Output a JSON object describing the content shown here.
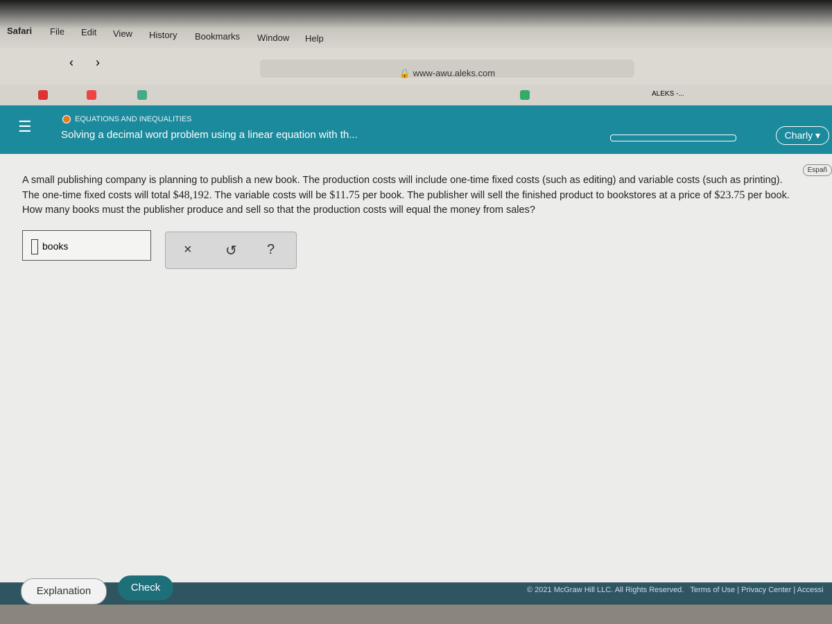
{
  "menubar": {
    "items": [
      "Safari",
      "File",
      "Edit",
      "View",
      "History",
      "Bookmarks",
      "Window",
      "Help"
    ]
  },
  "browser": {
    "url": "www-awu.aleks.com",
    "fav_aleks": "ALEKS -..."
  },
  "header": {
    "category": "EQUATIONS AND INEQUALITIES",
    "title": "Solving a decimal word problem using a linear equation with th...",
    "user": "Charly",
    "accent": "#1b8a9c"
  },
  "language": "Españ",
  "question": {
    "p1": "A small publishing company is planning to publish a new book. The production costs will include one-time fixed costs (such as editing) and variable costs (such as printing). The one-time fixed costs will total ",
    "fixed": "$48,192",
    "p2": ". The variable costs will be ",
    "variable": "$11.75",
    "p3": " per book. The publisher will sell the finished product to bookstores at a price of ",
    "price": "$23.75",
    "p4": " per book. How many books must the publisher produce and sell so that the production costs will equal the money from sales?"
  },
  "answer": {
    "value": "",
    "unit": "books"
  },
  "tools": {
    "clear": "×",
    "undo": "↺",
    "help": "?"
  },
  "buttons": {
    "explanation": "Explanation",
    "check": "Check"
  },
  "footer": {
    "copyright": "© 2021 McGraw Hill LLC. All Rights Reserved.",
    "terms": "Terms of Use",
    "privacy": "Privacy Center",
    "accessibility": "Accessi"
  }
}
